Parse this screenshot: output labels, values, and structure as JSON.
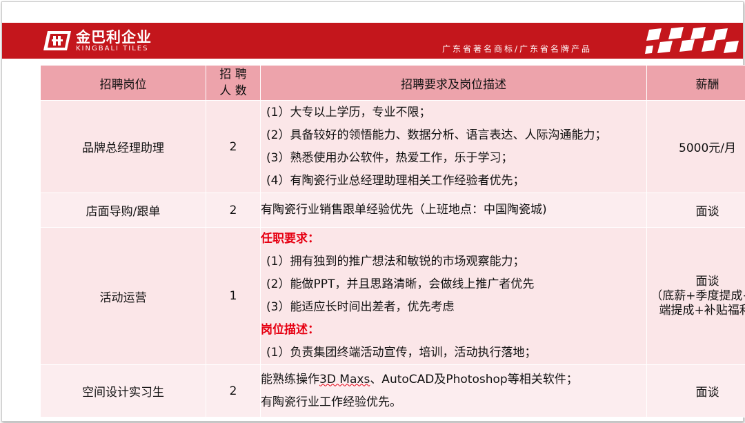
{
  "header": {
    "brand_cn": "金巴利企业",
    "brand_en": "KINGBALI TILES",
    "slogan": "广东省著名商标/广东省名牌产品",
    "colors": {
      "banner": "#c4161c",
      "header_row": "#eda3ab",
      "row_light": "#fbe6e8",
      "accent_red": "#e60012"
    }
  },
  "table": {
    "headers": {
      "position": "招聘岗位",
      "count_line1": "招 聘",
      "count_line2": "人 数",
      "requirements": "招聘要求及岗位描述",
      "salary": "薪酬"
    },
    "rows": [
      {
        "position": "品牌总经理助理",
        "count": "2",
        "lines": [
          "(1）大专以上学历，专业不限；",
          "(2）具备较好的领悟能力、数据分析、语言表达、人际沟通能力；",
          "(3）熟悉使用办公软件，热爱工作，乐于学习；",
          "(4）有陶瓷行业总经理助理相关工作经验者优先；"
        ],
        "salary": "5000元/月"
      },
      {
        "position": "店面导购/跟单",
        "count": "2",
        "lines": [
          "有陶瓷行业销售跟单经验优先（上班地点：中国陶瓷城)"
        ],
        "salary": "面谈"
      },
      {
        "position": "活动运营",
        "count": "1",
        "section1_title": "任职要求：",
        "section1_lines": [
          "(1）拥有独到的推广想法和敏锐的市场观察能力；",
          "(2）能做PPT，并且思路清晰，会做线上推广者优先",
          "(3）能适应长时间出差者，优先考虑"
        ],
        "section2_title": "岗位描述：",
        "section2_lines": [
          "(1）负责集团终端活动宣传，培训，活动执行落地；"
        ],
        "salary_line1": "面谈",
        "salary_line2": "（底薪+季度提成+终",
        "salary_line3": "端提成+补贴福利)"
      },
      {
        "position": "空间设计实习生",
        "count": "2",
        "line1_pre": "能熟练操作",
        "line1_underlined": "3D Maxs",
        "line1_post": "、AutoCAD及Photoshop等相关软件；",
        "line2": "有陶瓷行业工作经验优先。",
        "salary": "面谈"
      }
    ]
  }
}
